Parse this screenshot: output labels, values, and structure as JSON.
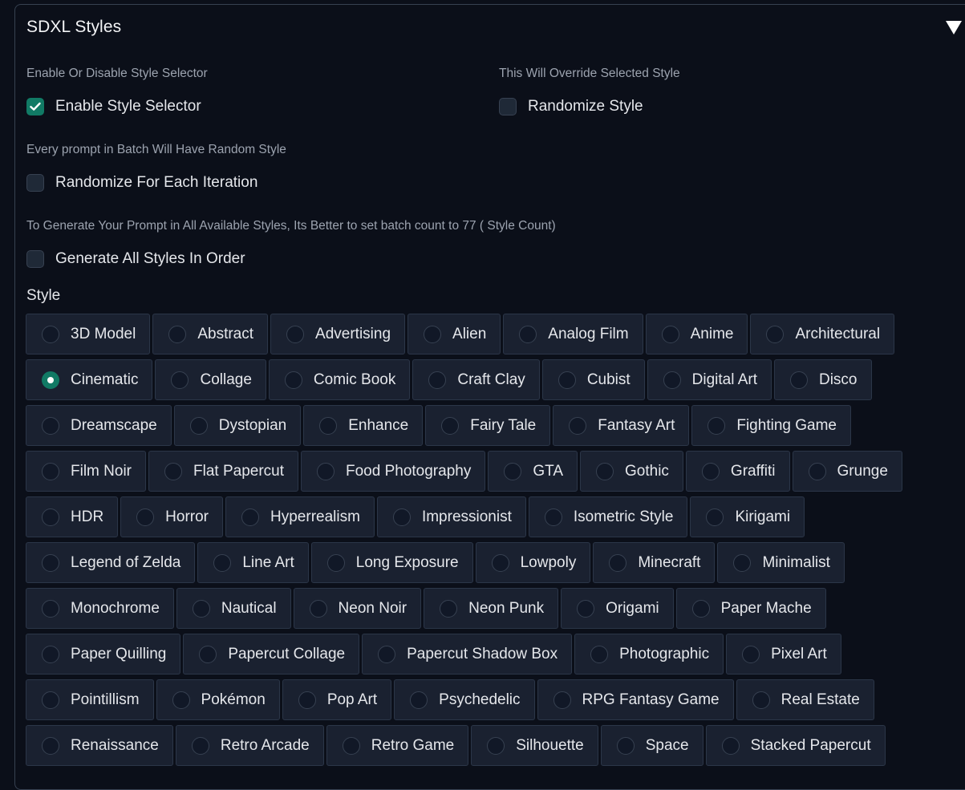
{
  "panel": {
    "title": "SDXL Styles"
  },
  "options": {
    "enable_info": "Enable Or Disable Style Selector",
    "enable_label": "Enable Style Selector",
    "enable_checked": true,
    "randomize_info": "This Will Override Selected Style",
    "randomize_label": "Randomize Style",
    "randomize_checked": false,
    "iteration_info": "Every prompt in Batch Will Have Random Style",
    "iteration_label": "Randomize For Each Iteration",
    "iteration_checked": false,
    "all_styles_info": "To Generate Your Prompt in All Available Styles, Its Better to set batch count to 77 ( Style Count)",
    "all_styles_label": "Generate All Styles In Order",
    "all_styles_checked": false
  },
  "style_group": {
    "label": "Style",
    "selected": "Cinematic",
    "rows": [
      [
        "3D Model",
        "Abstract",
        "Advertising",
        "Alien",
        "Analog Film",
        "Anime",
        "Architectural"
      ],
      [
        "Cinematic",
        "Collage",
        "Comic Book",
        "Craft Clay",
        "Cubist",
        "Digital Art",
        "Disco"
      ],
      [
        "Dreamscape",
        "Dystopian",
        "Enhance",
        "Fairy Tale",
        "Fantasy Art",
        "Fighting Game"
      ],
      [
        "Film Noir",
        "Flat Papercut",
        "Food Photography",
        "GTA",
        "Gothic",
        "Graffiti",
        "Grunge"
      ],
      [
        "HDR",
        "Horror",
        "Hyperrealism",
        "Impressionist",
        "Isometric Style",
        "Kirigami"
      ],
      [
        "Legend of Zelda",
        "Line Art",
        "Long Exposure",
        "Lowpoly",
        "Minecraft",
        "Minimalist"
      ],
      [
        "Monochrome",
        "Nautical",
        "Neon Noir",
        "Neon Punk",
        "Origami",
        "Paper Mache"
      ],
      [
        "Paper Quilling",
        "Papercut Collage",
        "Papercut Shadow Box",
        "Photographic",
        "Pixel Art"
      ],
      [
        "Pointillism",
        "Pokémon",
        "Pop Art",
        "Psychedelic",
        "RPG Fantasy Game",
        "Real Estate"
      ],
      [
        "Renaissance",
        "Retro Arcade",
        "Retro Game",
        "Silhouette",
        "Space",
        "Stacked Papercut"
      ]
    ]
  },
  "colors": {
    "accent": "#117a65",
    "background": "#0b0f19",
    "item_background": "#1a2130"
  }
}
